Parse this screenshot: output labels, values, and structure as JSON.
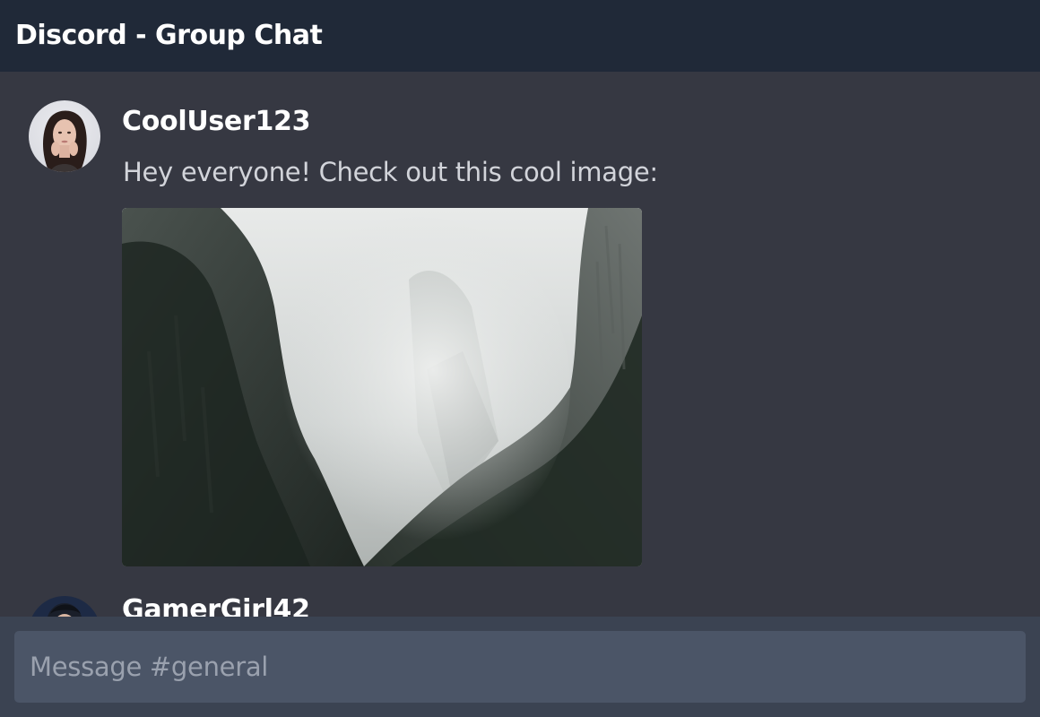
{
  "window": {
    "title": "Discord - Group Chat"
  },
  "messages": [
    {
      "username": "CoolUser123",
      "text": "Hey everyone! Check out this cool image:",
      "attachment": "misty-canyon-image",
      "avatar": "woman-portrait-avatar"
    },
    {
      "username": "GamerGirl42",
      "text": "",
      "avatar": "person-portrait-avatar"
    }
  ],
  "composer": {
    "placeholder": "Message #general",
    "value": ""
  },
  "colors": {
    "header_bg": "#202938",
    "chat_bg": "#363842",
    "input_bar_bg": "#3b4352",
    "input_bg": "#4b5567",
    "username": "#ffffff",
    "message_text": "#d2d4da",
    "placeholder": "#9aa1ae"
  }
}
